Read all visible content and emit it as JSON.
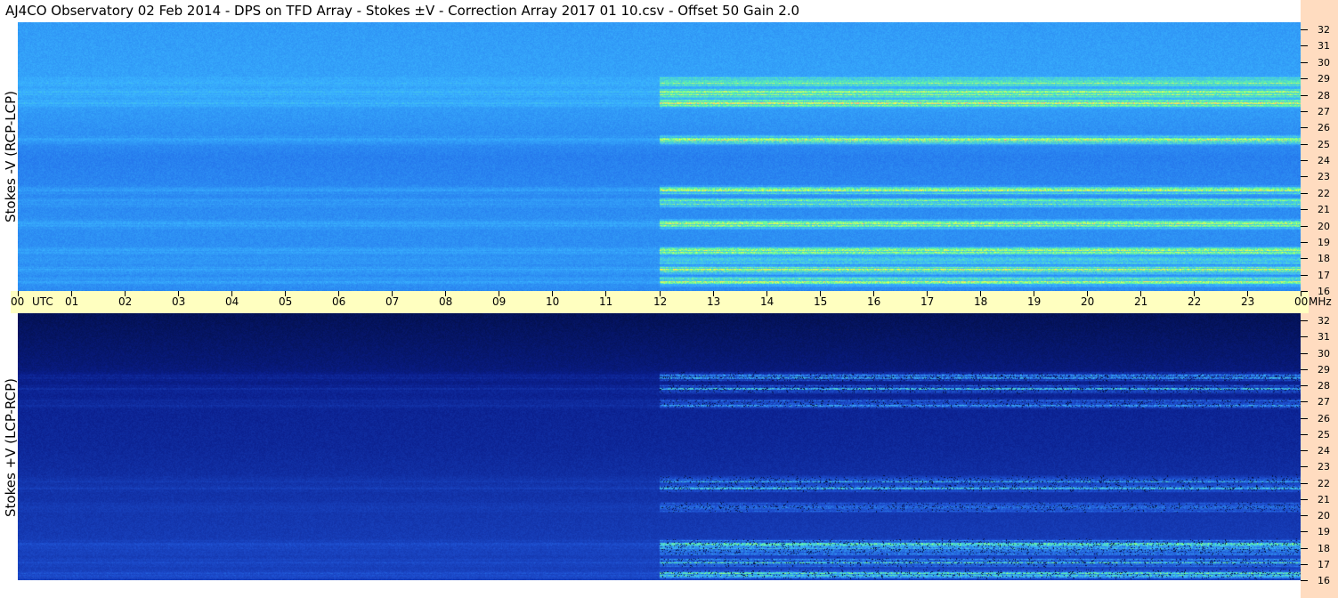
{
  "title": "AJ4CO Observatory  02 Feb 2014  -  DPS on TFD Array  -  Stokes ±V  -  Correction Array 2017 01 10.csv  -  Offset 50  Gain 2.0",
  "chart_data": {
    "type": "heatmap",
    "title": "AJ4CO Observatory  02 Feb 2014  -  DPS on TFD Array  -  Stokes ±V  -  Correction Array 2017 01 10.csv  -  Offset 50  Gain 2.0",
    "x_unit_label": "UTC",
    "y_unit_label": "MHz",
    "x_ticks": [
      "00",
      "01",
      "02",
      "03",
      "04",
      "05",
      "06",
      "07",
      "08",
      "09",
      "10",
      "11",
      "12",
      "13",
      "14",
      "15",
      "16",
      "17",
      "18",
      "19",
      "20",
      "21",
      "22",
      "23",
      "00"
    ],
    "y_ticks": [
      "32",
      "31",
      "30",
      "29",
      "28",
      "27",
      "26",
      "25",
      "24",
      "23",
      "22",
      "21",
      "20",
      "19",
      "18",
      "17",
      "16"
    ],
    "xlim_hours": [
      0,
      24
    ],
    "ylim_mhz": [
      16,
      32
    ],
    "panels": [
      {
        "name": "Stokes -V (RCP-LCP)",
        "ylabel": "Stokes -V (RCP-LCP)",
        "colormap": [
          "#0a1e8c",
          "#1e64e6",
          "#3ab4ff",
          "#66ff99",
          "#ffff44",
          "#ff44cc"
        ],
        "background_levels": [
          {
            "mhz": 32,
            "level": 0.34
          },
          {
            "mhz": 28,
            "level": 0.36
          },
          {
            "mhz": 24.8,
            "level": 0.3
          },
          {
            "mhz": 24,
            "level": 0.27
          },
          {
            "mhz": 20,
            "level": 0.31
          },
          {
            "mhz": 16,
            "level": 0.3
          }
        ],
        "active_after_utc": 12,
        "bands_mhz": [
          27.2,
          27.8,
          28.5,
          22.0,
          21.3,
          20.0,
          18.4,
          17.9,
          17.3,
          16.6,
          25.0
        ]
      },
      {
        "name": "Stokes +V (LCP-RCP)",
        "ylabel": "Stokes +V (LCP-RCP)",
        "colormap": [
          "#000a33",
          "#0a1e8c",
          "#1e50d2",
          "#3ab4ff",
          "#66ff99",
          "#ffff44"
        ],
        "background_levels": [
          {
            "mhz": 32,
            "level": 0.08
          },
          {
            "mhz": 29,
            "level": 0.15
          },
          {
            "mhz": 27,
            "level": 0.22
          },
          {
            "mhz": 24,
            "level": 0.24
          },
          {
            "mhz": 20,
            "level": 0.3
          },
          {
            "mhz": 16,
            "level": 0.34
          }
        ],
        "active_after_utc": 12,
        "bands_mhz": [
          27.5,
          28.2,
          26.6,
          22.0,
          21.6,
          20.4,
          18.2,
          17.8,
          17.1,
          16.4
        ]
      }
    ]
  }
}
